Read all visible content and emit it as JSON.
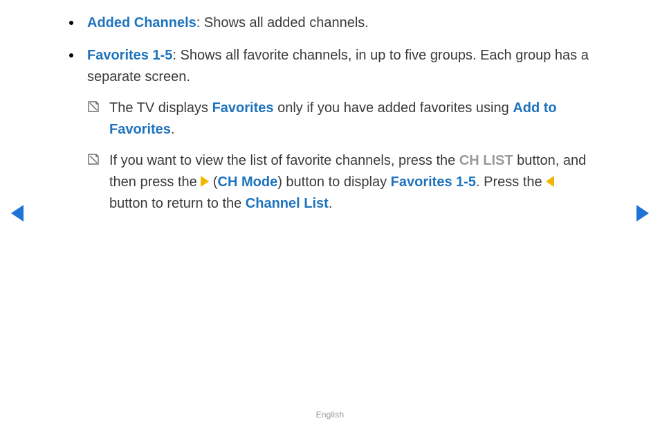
{
  "bullets": [
    {
      "term": "Added Channels",
      "desc": ": Shows all added channels."
    },
    {
      "term": "Favorites 1-5",
      "desc": ": Shows all favorite channels, in up to five groups. Each group has a separate screen.",
      "notes": [
        {
          "pre": "The TV displays ",
          "kw1": "Favorites",
          "mid": " only if you have added favorites using ",
          "kw2": "Add to Favorites",
          "post": "."
        },
        {
          "seg_a": "If you want to view the list of favorite channels, press the ",
          "chlist": "CH LIST",
          "seg_b": " button, and then press the ",
          "chmode": "CH Mode",
          "seg_c": ") button to display ",
          "fav": "Favorites 1-5",
          "seg_d": ". Press the ",
          "seg_e": " button to return to the ",
          "chlabel": "Channel List",
          "seg_f": "."
        }
      ]
    }
  ],
  "footer": "English",
  "open_paren": " ("
}
